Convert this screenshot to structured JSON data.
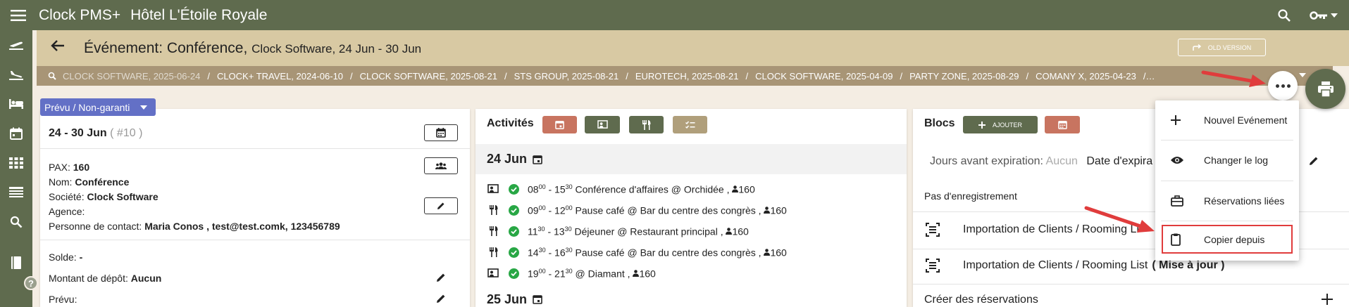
{
  "app": {
    "name": "Clock PMS+",
    "hotel": "Hôtel L'Étoile Royale",
    "colors": {
      "primary": "#5f6b4e",
      "header": "#d8c9a3",
      "breadcrumb": "#a89576",
      "status": "#6370c6",
      "highlight": "#e03c3c",
      "success": "#28a745"
    }
  },
  "topbar": {
    "icons": [
      "menu-icon",
      "search-icon",
      "key-icon"
    ]
  },
  "rail": {
    "icons": [
      "plane-departure-icon",
      "plane-arrival-icon",
      "bed-icon",
      "calendar-icon",
      "grid-icon",
      "table-icon",
      "search-icon",
      "book-icon"
    ],
    "help_label": "?"
  },
  "header": {
    "title": "Événement: Conférence,",
    "subtitle": "Clock Software, 24 Jun - 30 Jun",
    "old_version_label": "OLD VERSION"
  },
  "breadcrumb": {
    "items": [
      "CLOCK SOFTWARE, 2025-06-24",
      "CLOCK+ TRAVEL, 2024-06-10",
      "CLOCK SOFTWARE, 2025-08-21",
      "STS GROUP, 2025-08-21",
      "EUROTECH, 2025-08-21",
      "CLOCK SOFTWARE, 2025-04-09",
      "PARTY ZONE, 2025-08-29",
      "COMANY X, 2025-04-23"
    ],
    "separator": "/",
    "trail": "/…"
  },
  "status": {
    "label": "Prévu / Non-garanti"
  },
  "details": {
    "dates": "24 - 30 Jun",
    "number": "( #10 )",
    "pax_label": "PAX:",
    "pax_value": "160",
    "name_label": "Nom:",
    "name_value": "Conférence",
    "company_label": "Société:",
    "company_value": "Clock Software",
    "agency_label": "Agence:",
    "contact_label": "Personne de contact:",
    "contact_value": "Maria Conos , test@test.comk, 123456789",
    "balance_label": "Solde:",
    "balance_value": "-",
    "deposit_label": "Montant de dépôt:",
    "deposit_value": "Aucun",
    "planned_label": "Prévu:"
  },
  "activities": {
    "title": "Activités",
    "day1": "24 Jun",
    "day2": "25 Jun",
    "items": [
      {
        "icon": "presentation-icon",
        "start_h": "08",
        "start_m": "00",
        "end_h": "15",
        "end_m": "30",
        "text": "Conférence d'affaires @ Orchidée ,",
        "pax": "160"
      },
      {
        "icon": "utensils-icon",
        "start_h": "09",
        "start_m": "00",
        "end_h": "12",
        "end_m": "00",
        "text": "Pause café @ Bar du centre des congrès ,",
        "pax": "160"
      },
      {
        "icon": "utensils-icon",
        "start_h": "11",
        "start_m": "30",
        "end_h": "13",
        "end_m": "30",
        "text": "Déjeuner @ Restaurant principal ,",
        "pax": "160"
      },
      {
        "icon": "utensils-icon",
        "start_h": "14",
        "start_m": "30",
        "end_h": "16",
        "end_m": "30",
        "text": "Pause café @ Bar du centre des congrès ,",
        "pax": "160"
      },
      {
        "icon": "presentation-icon",
        "start_h": "19",
        "start_m": "00",
        "end_h": "21",
        "end_m": "30",
        "text": "@ Diamant ,",
        "pax": "160"
      }
    ]
  },
  "blocks": {
    "title": "Blocs",
    "add_label": "AJOUTER",
    "expiry_label": "Jours avant expiration:",
    "expiry_value": "Aucun",
    "expiry_date_label": "Date d'expira",
    "no_record": "Pas d'enregistrement",
    "import_label": "Importation de Clients / Rooming Li",
    "import2_label": "Importation de Clients / Rooming List",
    "import2_suffix": "( Mise à jour )",
    "create_label": "Créer des réservations"
  },
  "dropdown": {
    "items": [
      {
        "icon": "plus-icon",
        "label": "Nouvel Evénement"
      },
      {
        "icon": "eye-icon",
        "label": "Changer le log"
      },
      {
        "icon": "briefcase-icon",
        "label": "Réservations liées"
      },
      {
        "icon": "clipboard-icon",
        "label": "Copier depuis"
      }
    ]
  }
}
